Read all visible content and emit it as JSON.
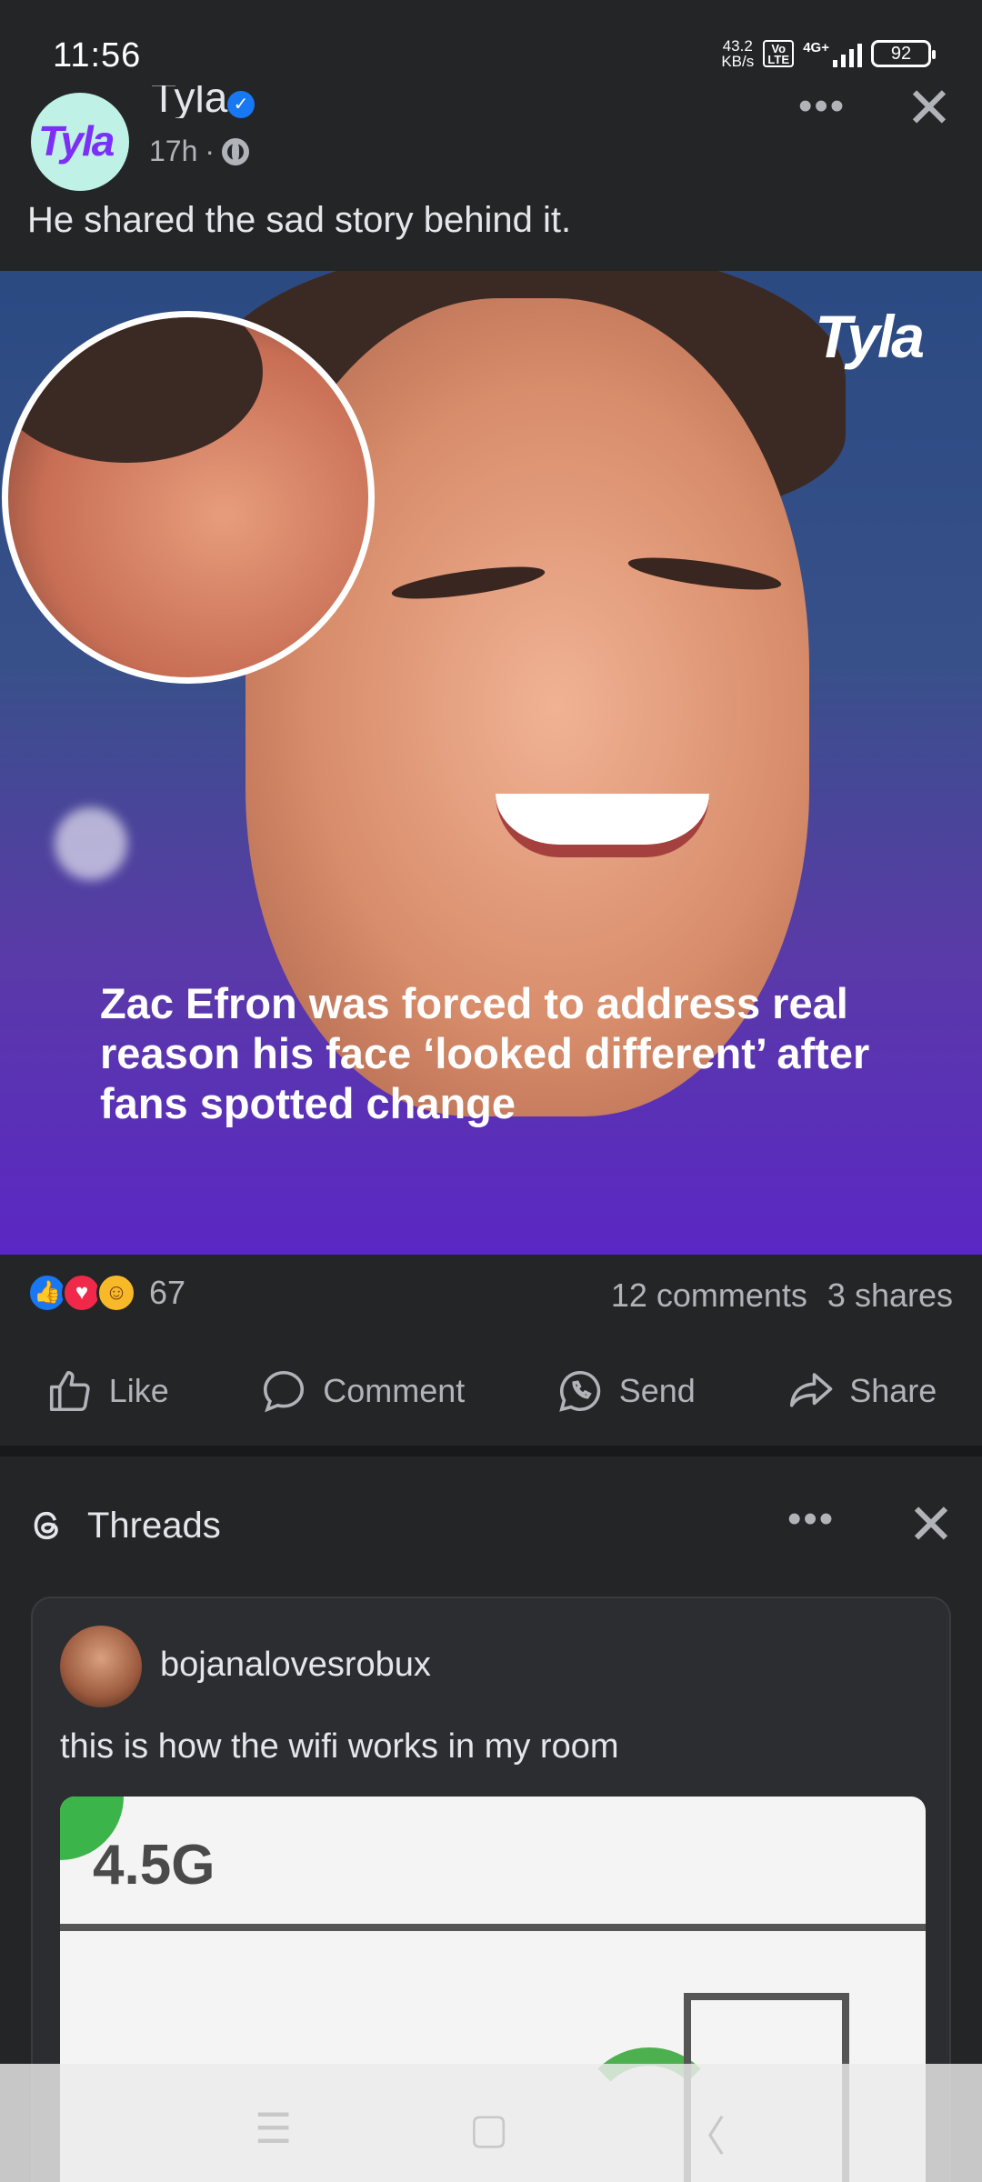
{
  "status_bar": {
    "time": "11:56",
    "net_speed_value": "43.2",
    "net_speed_unit": "KB/s",
    "volte": "Vo LTE",
    "network": "4G+",
    "battery": "92"
  },
  "post": {
    "page_name": "Tyla",
    "avatar_text": "Tyla",
    "time": "17h",
    "meta_sep": "·",
    "text": "He shared the sad story behind it.",
    "image": {
      "watermark": "Tyla",
      "headline": "Zac Efron was forced to address real reason his face ‘looked different’ after fans spotted change"
    },
    "reactions": {
      "count": "67",
      "comments": "12 comments",
      "shares": "3 shares"
    },
    "actions": {
      "like": "Like",
      "comment": "Comment",
      "send": "Send",
      "share": "Share"
    }
  },
  "threads": {
    "title": "Threads",
    "card": {
      "username": "bojanalovesrobux",
      "text": "this is how the wifi works in my room",
      "image_label": "4.5G"
    }
  },
  "colors": {
    "background": "#242527",
    "text": "#e4e6eb",
    "secondary_text": "#b0b3b8",
    "like_blue": "#1877f2",
    "love_red": "#f02849",
    "care_yellow": "#f7b928"
  }
}
